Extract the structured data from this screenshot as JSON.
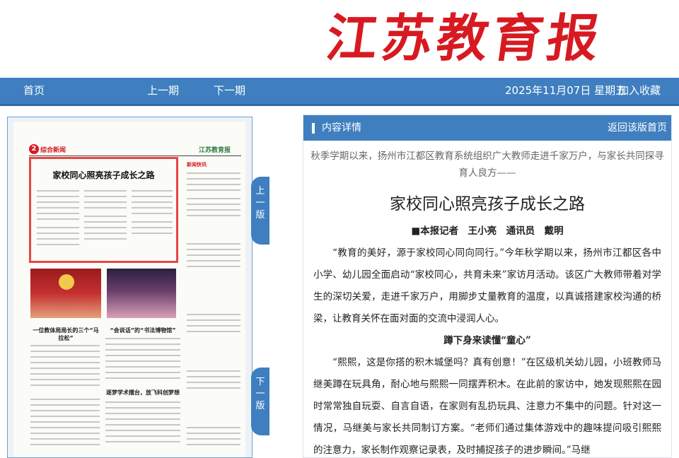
{
  "masthead": "江苏教育报",
  "nav": {
    "home": "首页",
    "prev_issue": "上一期",
    "next_issue": "下一期",
    "date": "2025年11月07日 星期五",
    "bookmark": "加入收藏"
  },
  "side": {
    "prev_page": "上一版",
    "next_page": "下一版"
  },
  "thumbnail": {
    "page_no": "2",
    "section": "综合新闻",
    "logo": "江苏教育报",
    "headline": "家校同心照亮孩子成长之路",
    "story2": "一位教体局局长的三个“马拉松”",
    "story3": "“会说话”的“书法博物馆”",
    "story4": "逐梦学术擂台，放飞科创梦想",
    "sidebar_title": "新闻快讯"
  },
  "content": {
    "panel_title": "内容详情",
    "back_link": "返回该版首页",
    "subtitle": "秋季学期以来，扬州市江都区教育系统组织广大教师走进千家万户，与家长共同探寻育人良方——",
    "headline": "家校同心照亮孩子成长之路",
    "byline": "■本报记者　王小亮　通讯员　戴明",
    "para1": "“教育的美好，源于家校同心同向同行。”今年秋学期以来，扬州市江都区各中小学、幼儿园全面启动“家校同心，共育未来”家访月活动。该区广大教师带着对学生的深切关爱，走进千家万户，用脚步丈量教育的温度，以真诚搭建家校沟通的桥梁，让教育关怀在面对面的交流中浸润人心。",
    "section1": "蹲下身来读懂“童心”",
    "para2": "“熙熙，这是你搭的积木城堡吗？真有创意！”在区级机关幼儿园，小班教师马继美蹲在玩具角，耐心地与熙熙一同摆弄积木。在此前的家访中，她发现熙熙在园时常常独自玩耍、自言自语，在家则有乱扔玩具、注意力不集中的问题。针对这一情况，马继美与家长共同制订方案。“老师们通过集体游戏中的趣味提问吸引熙熙的注意力，家长制作观察记录表，及时捕捉孩子的进步瞬间。”马继"
  }
}
